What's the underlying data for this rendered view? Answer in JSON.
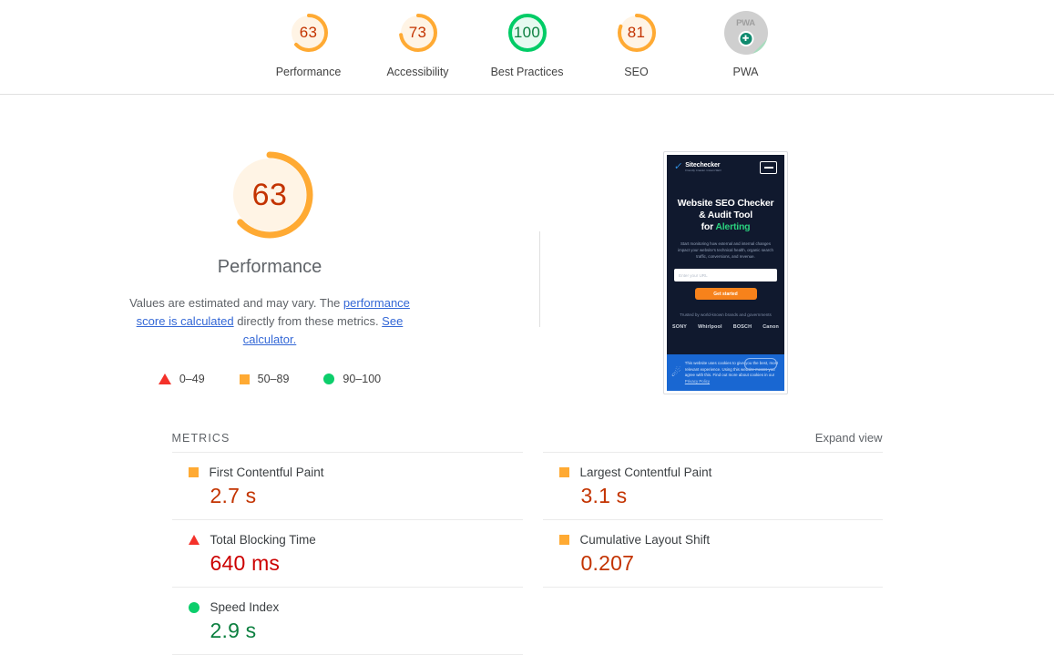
{
  "header": {
    "categories": [
      {
        "label": "Performance",
        "score": "63",
        "color": "#ffaa33",
        "bg": "#fff4e5",
        "text_color": "#c33300",
        "type": "gauge"
      },
      {
        "label": "Accessibility",
        "score": "73",
        "color": "#ffaa33",
        "bg": "#fff4e5",
        "text_color": "#c33300",
        "type": "gauge"
      },
      {
        "label": "Best Practices",
        "score": "100",
        "color": "#00cc66",
        "bg": "#e6faf0",
        "text_color": "#0b7f3f",
        "type": "gauge"
      },
      {
        "label": "SEO",
        "score": "81",
        "color": "#ffaa33",
        "bg": "#fff4e5",
        "text_color": "#c33300",
        "type": "gauge"
      },
      {
        "label": "PWA",
        "score": "",
        "badge_text": "PWA",
        "type": "badge"
      }
    ]
  },
  "hero": {
    "gauge": {
      "score": "63",
      "title": "Performance",
      "arc_color": "#ffaa33",
      "fill_color": "#fff4e5",
      "text_color": "#c33300",
      "percent": 63
    },
    "description": {
      "part1": "Values are estimated and may vary. The ",
      "link1": "performance score is calculated",
      "part2": " directly from these metrics. ",
      "link2": "See calculator."
    },
    "legend": [
      {
        "marker": "triangle-icon",
        "range": "0–49"
      },
      {
        "marker": "square-icon",
        "range": "50–89"
      },
      {
        "marker": "circle-icon",
        "range": "90–100"
      }
    ]
  },
  "thumbnail": {
    "brand": "Sitechecker",
    "brand_sub": "Friendly Crawler. Instant SEO",
    "headline_line1": "Website SEO Checker",
    "headline_line2": "& Audit Tool",
    "headline_line3_prefix": "for ",
    "headline_line3_accent": "Alerting",
    "subtext": "Start monitoring how external and internal changes impact your website's technical health, organic search traffic, conversions, and revenue.",
    "input_placeholder": "Enter your URL",
    "cta_label": "Get started",
    "trusted_text": "Trusted by world-known brands and governments",
    "logos": [
      "SONY",
      "Whirlpool",
      "BOSCH",
      "Canon"
    ],
    "cookie_text": "This website uses cookies to give you the best, most relevant experience. Using this website means you agree with this. Find out more about cookies in our ",
    "cookie_link": "Privacy Policy",
    "menu_icon": "hamburger-menu-icon"
  },
  "metrics": {
    "section_title": "METRICS",
    "expand_label": "Expand view",
    "items": [
      {
        "name": "First Contentful Paint",
        "value": "2.7 s",
        "rating": "average",
        "marker": "square-icon",
        "value_class": "v-orange"
      },
      {
        "name": "Largest Contentful Paint",
        "value": "3.1 s",
        "rating": "average",
        "marker": "square-icon",
        "value_class": "v-orange"
      },
      {
        "name": "Total Blocking Time",
        "value": "640 ms",
        "rating": "poor",
        "marker": "triangle-icon",
        "value_class": "v-red"
      },
      {
        "name": "Cumulative Layout Shift",
        "value": "0.207",
        "rating": "average",
        "marker": "square-icon",
        "value_class": "v-orange"
      },
      {
        "name": "Speed Index",
        "value": "2.9 s",
        "rating": "good",
        "marker": "circle-icon",
        "value_class": "v-green"
      }
    ]
  }
}
